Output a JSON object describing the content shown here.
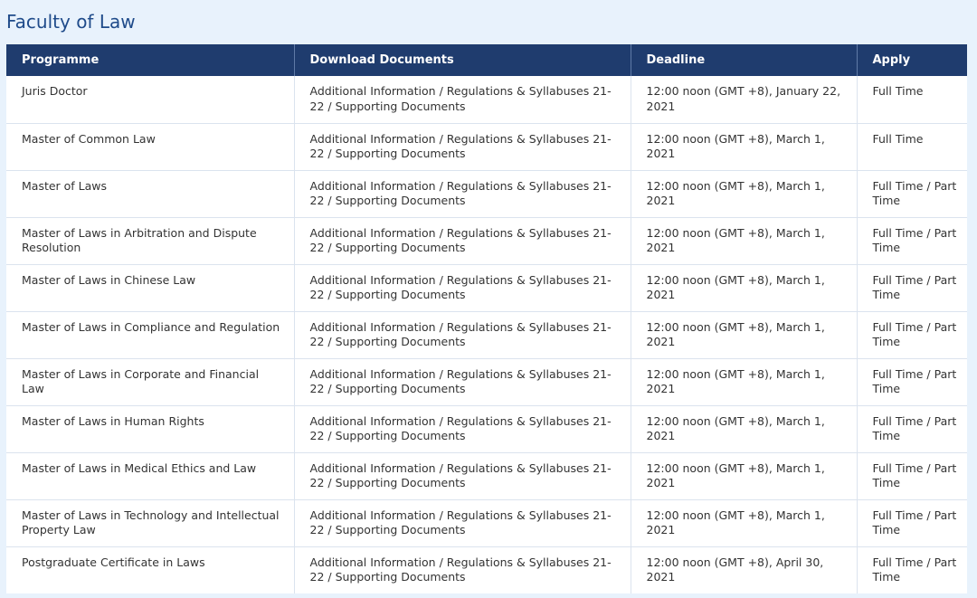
{
  "page": {
    "title": "Faculty of Law"
  },
  "table": {
    "headers": [
      "Programme",
      "Download Documents",
      "Deadline",
      "Apply"
    ],
    "rows": [
      {
        "programme": "Juris Doctor",
        "documents": [
          "Additional Information",
          "Regulations & Syllabuses 21-22",
          "Supporting Documents"
        ],
        "deadline": "12:00 noon (GMT +8), January 22, 2021",
        "apply": "Full Time"
      },
      {
        "programme": "Master of Common Law",
        "documents": [
          "Additional Information",
          "Regulations & Syllabuses 21-22",
          "Supporting Documents"
        ],
        "deadline": "12:00 noon (GMT +8), March 1, 2021",
        "apply": "Full Time"
      },
      {
        "programme": "Master of Laws",
        "documents": [
          "Additional Information",
          "Regulations & Syllabuses 21-22",
          "Supporting Documents"
        ],
        "deadline": "12:00 noon (GMT +8), March 1, 2021",
        "apply": "Full Time / Part Time"
      },
      {
        "programme": "Master of Laws in Arbitration and Dispute Resolution",
        "documents": [
          "Additional Information",
          "Regulations & Syllabuses 21-22",
          "Supporting Documents"
        ],
        "deadline": "12:00 noon (GMT +8), March 1, 2021",
        "apply": "Full Time / Part Time"
      },
      {
        "programme": "Master of Laws in Chinese Law",
        "documents": [
          "Additional Information",
          "Regulations & Syllabuses 21-22",
          "Supporting Documents"
        ],
        "deadline": "12:00 noon (GMT +8), March 1, 2021",
        "apply": "Full Time / Part Time"
      },
      {
        "programme": "Master of Laws in Compliance and Regulation",
        "documents": [
          "Additional Information",
          "Regulations & Syllabuses 21-22",
          "Supporting Documents"
        ],
        "deadline": "12:00 noon (GMT +8), March 1, 2021",
        "apply": "Full Time / Part Time"
      },
      {
        "programme": "Master of Laws in Corporate and Financial Law",
        "documents": [
          "Additional Information",
          "Regulations & Syllabuses 21-22",
          "Supporting Documents"
        ],
        "deadline": "12:00 noon (GMT +8), March 1, 2021",
        "apply": "Full Time / Part Time"
      },
      {
        "programme": "Master of Laws in Human Rights",
        "documents": [
          "Additional Information",
          "Regulations & Syllabuses 21-22",
          "Supporting Documents"
        ],
        "deadline": "12:00 noon (GMT +8), March 1, 2021",
        "apply": "Full Time / Part Time"
      },
      {
        "programme": "Master of Laws in Medical Ethics and Law",
        "documents": [
          "Additional Information",
          "Regulations & Syllabuses 21-22",
          "Supporting Documents"
        ],
        "deadline": "12:00 noon (GMT +8), March 1, 2021",
        "apply": "Full Time / Part Time"
      },
      {
        "programme": "Master of Laws in Technology and Intellectual Property Law",
        "documents": [
          "Additional Information",
          "Regulations & Syllabuses 21-22",
          "Supporting Documents"
        ],
        "deadline": "12:00 noon (GMT +8), March 1, 2021",
        "apply": "Full Time / Part Time"
      },
      {
        "programme": "Postgraduate Certificate in Laws",
        "documents": [
          "Additional Information",
          "Regulations & Syllabuses 21-22",
          "Supporting Documents"
        ],
        "deadline": "12:00 noon (GMT +8), April 30, 2021",
        "apply": "Full Time / Part Time"
      }
    ]
  },
  "colors": {
    "page_background": "#e8f2fc",
    "title_text": "#1f4b8a",
    "header_background": "#1f3c6e",
    "header_text": "#ffffff",
    "cell_background": "#ffffff",
    "cell_text": "#333333",
    "grid_line": "#dbe3ee"
  }
}
